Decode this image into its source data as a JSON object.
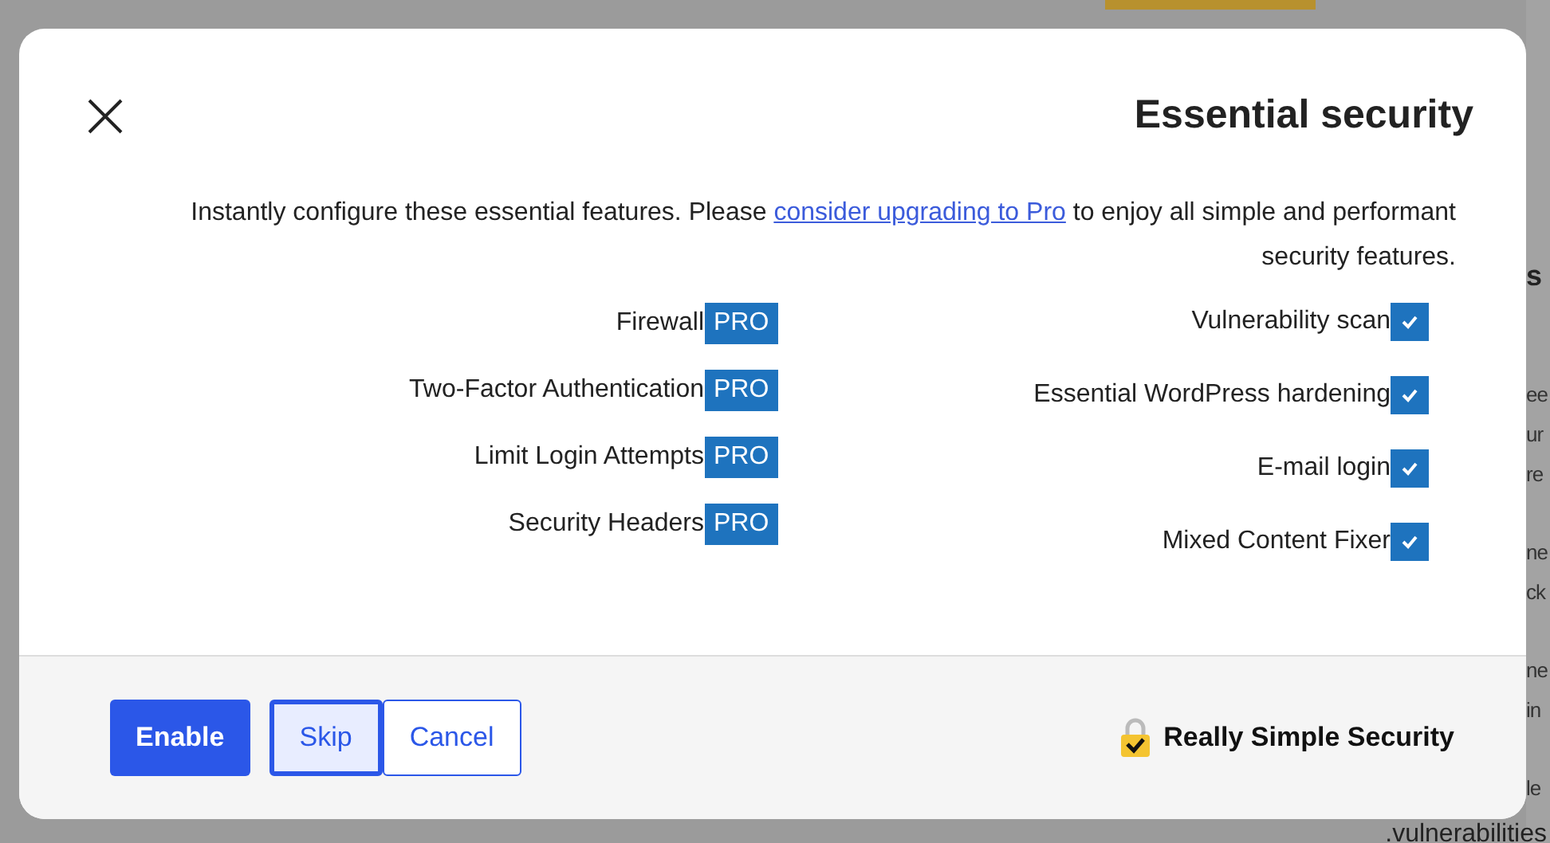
{
  "background": {
    "heading": "s",
    "line_groups": [
      [
        "ee",
        "ur",
        "re"
      ],
      [
        "ne",
        "ck"
      ],
      [
        "ne",
        "in"
      ],
      [
        "le"
      ]
    ],
    "last_line": "vulnerabilities."
  },
  "dialog": {
    "title": "Essential security",
    "description": {
      "before": "Instantly configure these essential features. Please ",
      "link": "consider upgrading to Pro",
      "after": " to enjoy all simple and performant security features."
    },
    "columns": [
      [
        {
          "label": "Firewall",
          "kind": "pro",
          "badge": "PRO"
        },
        {
          "label": "Two-Factor Authentication",
          "kind": "pro",
          "badge": "PRO"
        },
        {
          "label": "Limit Login Attempts",
          "kind": "pro",
          "badge": "PRO"
        },
        {
          "label": "Security Headers",
          "kind": "pro",
          "badge": "PRO"
        }
      ],
      [
        {
          "label": "Vulnerability scan",
          "kind": "checkbox",
          "checked": true
        },
        {
          "label": "Essential WordPress hardening",
          "kind": "checkbox",
          "checked": true
        },
        {
          "label": "E-mail login",
          "kind": "checkbox",
          "checked": true
        },
        {
          "label": "Mixed Content Fixer",
          "kind": "checkbox",
          "checked": true
        }
      ]
    ],
    "buttons": [
      {
        "label": "Enable",
        "kind": "primary",
        "focused": false
      },
      {
        "label": "Skip",
        "kind": "secondary",
        "focused": true
      },
      {
        "label": "Cancel",
        "kind": "secondary",
        "focused": false
      }
    ],
    "brand": "Really Simple Security"
  }
}
